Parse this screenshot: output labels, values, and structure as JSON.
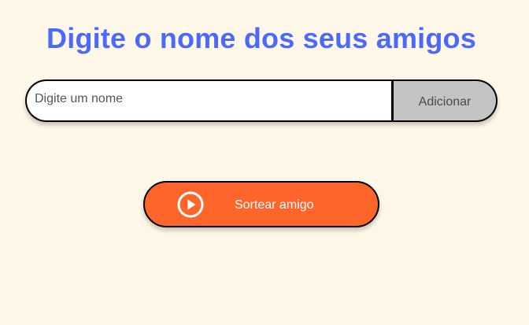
{
  "header": {
    "title": "Digite o nome dos seus amigos"
  },
  "form": {
    "name_placeholder": "Digite um nome",
    "name_value": "",
    "add_label": "Adicionar"
  },
  "actions": {
    "draw_label": "Sortear amigo",
    "draw_icon": "play-circle-icon"
  },
  "colors": {
    "background": "#fff8e8",
    "title": "#4b69fd",
    "add_button": "#c4c4c4",
    "draw_button": "#fe652b"
  }
}
